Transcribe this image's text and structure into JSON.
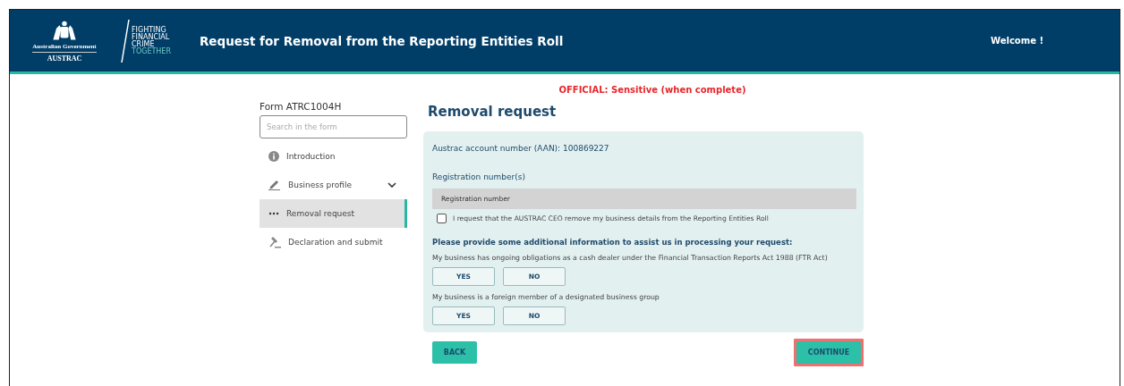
{
  "header": {
    "gov_name": "Australian Government",
    "agency": "AUSTRAC",
    "slogan": [
      "FIGHTING",
      "FINANCIAL",
      "CRIME",
      "TOGETHER"
    ],
    "title": "Request for Removal from the Reporting Entities Roll",
    "welcome": "Welcome !"
  },
  "classification": "OFFICIAL: Sensitive (when complete)",
  "sidebar": {
    "form_id": "Form ATRC1004H",
    "search": {
      "placeholder": "Search in the form"
    },
    "items": [
      {
        "label": "Introduction",
        "selected": false
      },
      {
        "label": "Business profile",
        "selected": false,
        "expanded": false
      },
      {
        "label": "Removal request",
        "selected": true
      },
      {
        "label": "Declaration and submit",
        "selected": false
      }
    ]
  },
  "main": {
    "heading": "Removal request",
    "aan": "Austrac account number (AAN): 100869227",
    "reg_label": "Registration number(s)",
    "reg_column": "Registration number",
    "request": {
      "label": "I request that the AUSTRAC CEO remove my business details from the Reporting Entities Roll",
      "checked": false
    },
    "info_heading": "Please provide some additional information to assist us in processing your request:",
    "questions": [
      {
        "text": "My business has ongoing obligations as a cash dealer under the Financial Transaction Reports Act 1988 (FTR Act)",
        "options": [
          {
            "label": "YES",
            "selected": false
          },
          {
            "label": "NO",
            "selected": false
          }
        ]
      },
      {
        "text": "My business is a foreign member of a designated business group",
        "options": [
          {
            "label": "YES",
            "selected": false
          },
          {
            "label": "NO",
            "selected": false
          }
        ]
      }
    ],
    "back": "BACK",
    "continue": {
      "label": "CONTINUE",
      "highlighted": true
    }
  }
}
